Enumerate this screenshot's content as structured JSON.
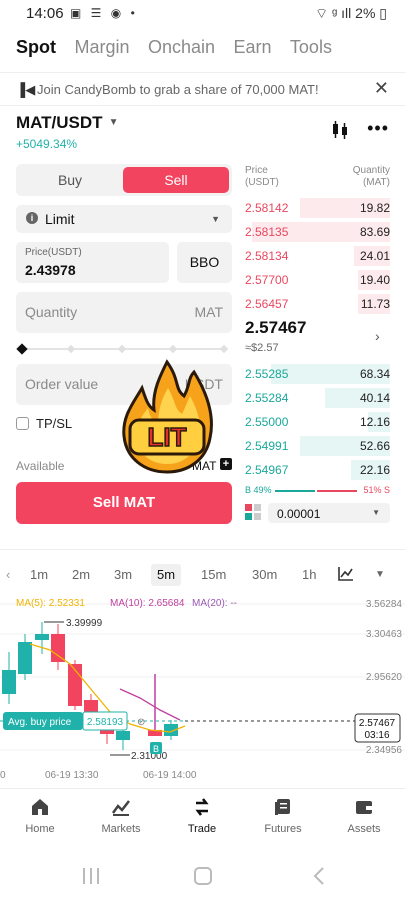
{
  "status_bar": {
    "time": "14:06",
    "battery": "2%"
  },
  "top_nav": {
    "tabs": [
      "Spot",
      "Margin",
      "Onchain",
      "Earn",
      "Tools"
    ],
    "active": "Spot"
  },
  "banner": {
    "text": "Join CandyBomb to grab a share of 70,000 MAT!",
    "close": "✕"
  },
  "pair": {
    "symbol": "MAT/USDT",
    "change": "+5049.34%"
  },
  "order_form": {
    "buy_label": "Buy",
    "sell_label": "Sell",
    "order_type": "Limit",
    "price_label": "Price(USDT)",
    "price_value": "2.43978",
    "bbo_label": "BBO",
    "quantity_placeholder": "Quantity",
    "quantity_unit": "MAT",
    "order_value_placeholder": "Order value",
    "order_value_unit": "USDT",
    "tpsl_label": "TP/SL",
    "available_label": "Available",
    "available_value": "MAT",
    "sell_button": "Sell MAT"
  },
  "sticker": {
    "text": "LIT"
  },
  "order_book": {
    "price_header_1": "Price",
    "price_header_2": "(USDT)",
    "qty_header_1": "Quantity",
    "qty_header_2": "(MAT)",
    "asks": [
      {
        "price": "2.58142",
        "qty": "19.82",
        "depth": 0.62
      },
      {
        "price": "2.58135",
        "qty": "83.69",
        "depth": 0.95
      },
      {
        "price": "2.58134",
        "qty": "24.01",
        "depth": 0.25
      },
      {
        "price": "2.57700",
        "qty": "19.40",
        "depth": 0.22
      },
      {
        "price": "2.56457",
        "qty": "11.73",
        "depth": 0.22
      }
    ],
    "mid_price": "2.57467",
    "mid_fiat": "≈$2.57",
    "bids": [
      {
        "price": "2.55285",
        "qty": "68.34",
        "depth": 0.82
      },
      {
        "price": "2.55284",
        "qty": "40.14",
        "depth": 0.45
      },
      {
        "price": "2.55000",
        "qty": "12.16",
        "depth": 0.15
      },
      {
        "price": "2.54991",
        "qty": "52.66",
        "depth": 0.62
      },
      {
        "price": "2.54967",
        "qty": "22.16",
        "depth": 0.27
      }
    ],
    "buy_ratio": "B 49%",
    "sell_ratio": "51% S",
    "depth_value": "0.00001"
  },
  "timeframes": [
    "1m",
    "2m",
    "3m",
    "5m",
    "15m",
    "30m",
    "1h"
  ],
  "active_timeframe": "5m",
  "chart": {
    "ma5_label": "MA(5): 2.52331",
    "ma10_label": "MA(10): 2.65684",
    "ma20_label": "MA(20): --",
    "high_label": "3.39999",
    "low_label": "2.31000",
    "y_ticks": [
      "3.56284",
      "3.30463",
      "2.95620",
      "2.34956"
    ],
    "last_price": "2.57467",
    "countdown": "03:16",
    "avg_buy_label": "Avg. buy price",
    "avg_buy_value": "2.58193",
    "x_labels": [
      "0",
      "06-19 13:30",
      "06-19 14:00"
    ],
    "marker": "B",
    "colors": {
      "up": "#20b2aa",
      "down": "#f2445f",
      "ma5": "#f0b400",
      "ma10": "#c13fa0",
      "ma20": "#9b59b6"
    }
  },
  "bottom_nav": [
    {
      "label": "Home",
      "icon": "home-icon"
    },
    {
      "label": "Markets",
      "icon": "markets-icon"
    },
    {
      "label": "Trade",
      "icon": "trade-icon"
    },
    {
      "label": "Futures",
      "icon": "futures-icon"
    },
    {
      "label": "Assets",
      "icon": "assets-icon"
    }
  ],
  "active_nav": "Trade"
}
